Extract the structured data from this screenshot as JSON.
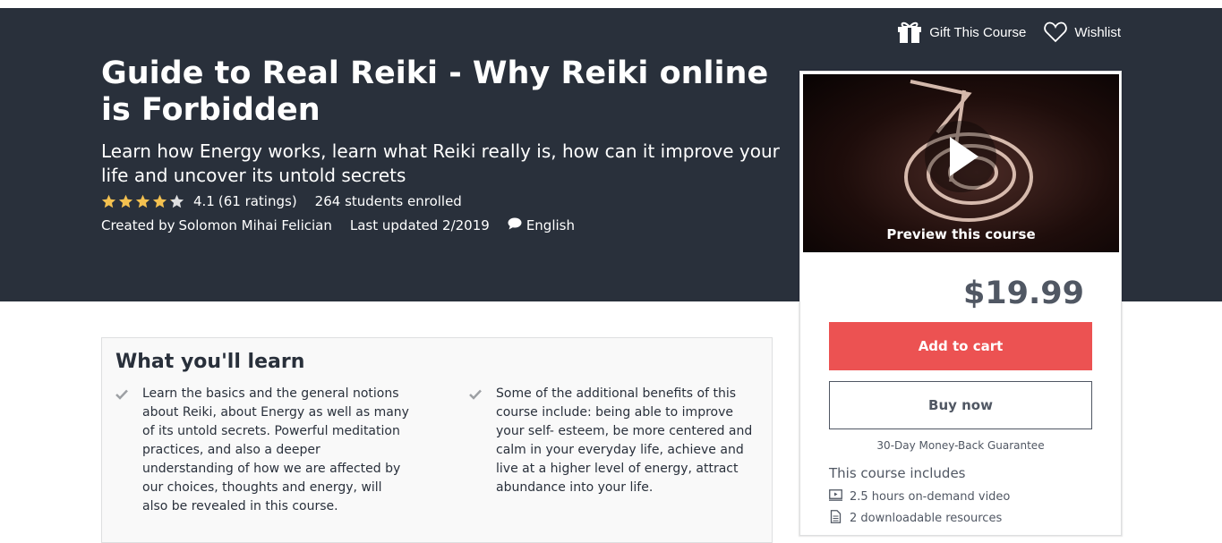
{
  "header": {
    "gift_label": "Gift This Course",
    "wishlist_label": "Wishlist"
  },
  "course": {
    "title": "Guide to Real Reiki - Why Reiki online is Forbidden",
    "subtitle": "Learn how Energy works, learn what Reiki really is, how can it improve your life and uncover its untold secrets",
    "rating_value": "4.1",
    "rating_count": "(61 ratings)",
    "rating_stars": 4.1,
    "enrolled": "264 students enrolled",
    "created_by_prefix": "Created by",
    "creator": "Solomon Mihai Felician",
    "last_updated": "Last updated 2/2019",
    "language": "English"
  },
  "sidebar": {
    "preview_label": "Preview this course",
    "price": "$19.99",
    "add_to_cart": "Add to cart",
    "buy_now": "Buy now",
    "guarantee": "30-Day Money-Back Guarantee",
    "includes_title": "This course includes",
    "includes": [
      {
        "icon": "video-icon",
        "text": "2.5 hours on-demand video"
      },
      {
        "icon": "file-icon",
        "text": "2 downloadable resources"
      }
    ]
  },
  "learn": {
    "title": "What you'll learn",
    "items": [
      "Learn the basics and the general notions about Reiki, about Energy as well as many of its untold secrets. Powerful meditation practices, and also a deeper understanding of how we are affected by our choices, thoughts and energy, will also be revealed in this course.",
      "Some of the additional benefits of this course include: being able to improve your self- esteem, be more centered and calm in your everyday life, achieve and live at a higher level of energy, attract abundance into your life."
    ]
  },
  "colors": {
    "hero_bg": "#29303b",
    "star": "#f4c150",
    "cart_button": "#ec5252"
  }
}
